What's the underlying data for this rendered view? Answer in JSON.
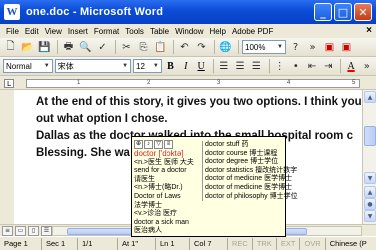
{
  "window": {
    "title": "one.doc - Microsoft Word",
    "app_icon_letter": "W"
  },
  "menu": {
    "items": [
      "File",
      "Edit",
      "View",
      "Insert",
      "Format",
      "Tools",
      "Table",
      "Window",
      "Help",
      "Adobe PDF"
    ],
    "close_glyph": "×"
  },
  "toolbar": {
    "zoom": "100%",
    "style": "Normal",
    "font": "宋体",
    "size": "12",
    "bold": "B",
    "italic": "I",
    "underline": "U",
    "font_color": "A"
  },
  "document": {
    "lines": [
      "At the end of this story, it gives you two options. I think you will f",
      "out what option I chose.",
      "Dallas as the doctor walked into the small hospital room c",
      "Blessing. She wa"
    ]
  },
  "ruler": {
    "numbers": [
      "1",
      "2",
      "3",
      "4",
      "5"
    ]
  },
  "popup": {
    "headword": "doctor ['dɔktə]",
    "left_lines": [
      "<n.>医生 医师 大夫",
      "send for a doctor",
      "请医生",
      "<n.>博士(略Dr.)",
      "Doctor of Laws",
      "法学博士",
      "<v.>诊治 医疗",
      "doctor a sick man",
      "医治病人"
    ],
    "right_lines": [
      "doctor stuff 药",
      "doctor course 博士课程",
      "doctor degree 博士学位",
      "doctor statistics 擅改统计数字",
      "doctor of medicine 医学博士",
      "doctor of medicine 医学博士",
      "doctor of philosophy 博士学位"
    ]
  },
  "status": {
    "page": "Page 1",
    "sec": "Sec 1",
    "pages": "1/1",
    "at": "At 1\"",
    "ln": "Ln 1",
    "col": "Col 7",
    "rec": "REC",
    "trk": "TRK",
    "ext": "EXT",
    "ovr": "OVR",
    "lang": "Chinese (P"
  }
}
